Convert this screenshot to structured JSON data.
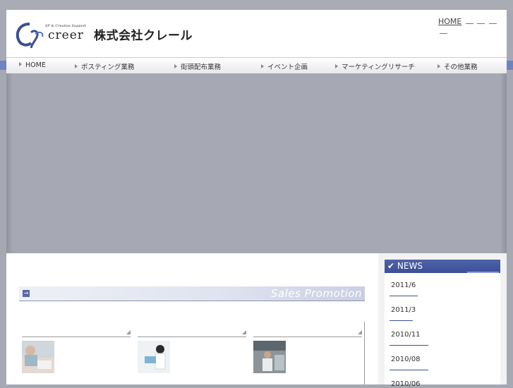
{
  "header": {
    "logo_tagline": "SP & Creative Support",
    "logo_word": "creer",
    "company_name": "株式会社クレール",
    "top_link_home": "HOME"
  },
  "nav": {
    "items": [
      {
        "label": "HOME"
      },
      {
        "label": "ポスティング業務"
      },
      {
        "label": "街頭配布業務"
      },
      {
        "label": "イベント企画"
      },
      {
        "label": "マーケティングリサーチ"
      },
      {
        "label": "その他業務"
      }
    ]
  },
  "main": {
    "section_title": "Sales Promotion"
  },
  "news": {
    "title": "NEWS",
    "items": [
      {
        "label": "2011/6"
      },
      {
        "label": "2011/3"
      },
      {
        "label": "2010/11"
      },
      {
        "label": "2010/08"
      },
      {
        "label": "2010/06"
      }
    ]
  },
  "colors": {
    "accent": "#3a4f97",
    "hero_gray": "#a6a9b3"
  }
}
